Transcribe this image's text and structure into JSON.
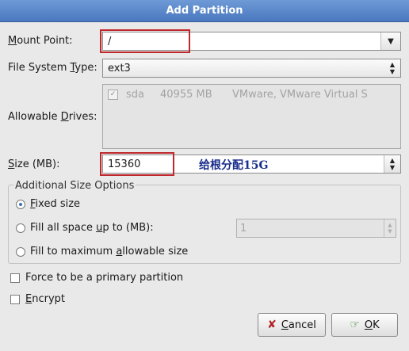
{
  "window": {
    "title": "Add Partition"
  },
  "mount_point": {
    "label_pre": "",
    "label_ul": "M",
    "label_post": "ount Point:",
    "value": "/"
  },
  "fs_type": {
    "label_pre": "File System ",
    "label_ul": "T",
    "label_post": "ype:",
    "value": "ext3"
  },
  "drives": {
    "label_pre": "Allowable ",
    "label_ul": "D",
    "label_post": "rives:",
    "rows": [
      {
        "checked": true,
        "name": "sda",
        "size": "40955 MB",
        "model": "VMware, VMware Virtual S"
      }
    ]
  },
  "size": {
    "label_pre": "",
    "label_ul": "S",
    "label_post": "ize (MB):",
    "value": "15360",
    "annotation": "给根分配15G"
  },
  "additional": {
    "title": "Additional Size Options",
    "options": [
      {
        "pre": "",
        "ul": "F",
        "post": "ixed size",
        "selected": true
      },
      {
        "pre": "Fill all space ",
        "ul": "u",
        "post": "p to (MB):",
        "selected": false
      },
      {
        "pre": "Fill to maximum ",
        "ul": "a",
        "post": "llowable size",
        "selected": false
      }
    ],
    "fill_up_to_value": "1"
  },
  "primary": {
    "label": "Force to be a primary partition",
    "checked": false
  },
  "encrypt": {
    "label_pre": "",
    "label_ul": "E",
    "label_post": "ncrypt",
    "checked": false
  },
  "buttons": {
    "cancel": {
      "pre": "",
      "ul": "C",
      "post": "ancel",
      "icon": "cancel-x-icon"
    },
    "ok": {
      "pre": "",
      "ul": "O",
      "post": "K",
      "icon": "ok-hand-icon"
    }
  },
  "colors": {
    "titlebar": "#4a78bf",
    "highlight_box": "#c0282d",
    "annotation": "#1a2d8c"
  }
}
